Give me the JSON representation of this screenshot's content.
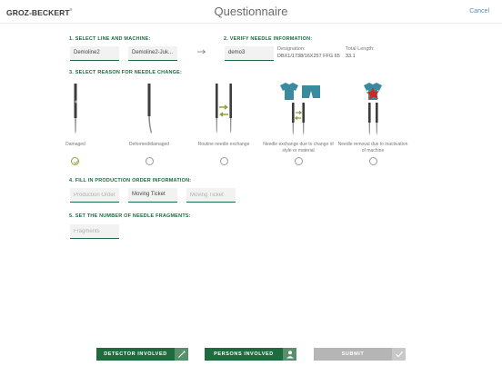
{
  "header": {
    "logo": "GROZ-BECKERT",
    "logo_mark": "®",
    "title": "Questionnaire",
    "cancel_label": "Cancel"
  },
  "section1": {
    "label": "1. SELECT LINE AND MACHINE:",
    "line_value": "Demoline2",
    "machine_value": "Demoline2-Juk..."
  },
  "section2": {
    "label": "2. VERIFY NEEDLE INFORMATION:",
    "needle_value": "demo3",
    "designation_label": "Designation:",
    "designation_value": "DBX1/1738/16X257 FFG 65",
    "total_length_label": "Total Length:",
    "total_length_value": "33.1"
  },
  "section3": {
    "label": "3. SELECT REASON FOR NEEDLE CHANGE:",
    "options": [
      {
        "label": "Damaged",
        "checked": true
      },
      {
        "label": "Deformed/damaged",
        "checked": false
      },
      {
        "label": "Routine needle exchange",
        "checked": false
      },
      {
        "label": "Needle exchange due to change of style or material",
        "checked": false
      },
      {
        "label": "Needle removal due to inactivation of machine",
        "checked": false
      }
    ]
  },
  "section4": {
    "label": "4. FILL IN PRODUCTION ORDER INFORMATION:",
    "production_order_placeholder": "Production Order",
    "moving_ticket_value": "Moving Ticket",
    "moving_ticket2_placeholder": "Moving Ticket"
  },
  "section5": {
    "label": "5. SET THE NUMBER OF NEEDLE FRAGMENTS:",
    "fragments_placeholder": "Fragments"
  },
  "buttons": {
    "detector_label": "DETECTOR INVOLVED",
    "persons_label": "PERSONS INVOLVED",
    "submit_label": "SUBMIT"
  },
  "colors": {
    "brand_green": "#1e6b3d",
    "accent_olive": "#8ba43a",
    "link_blue": "#4f8fbd",
    "disabled_grey": "#b5b5b5"
  }
}
